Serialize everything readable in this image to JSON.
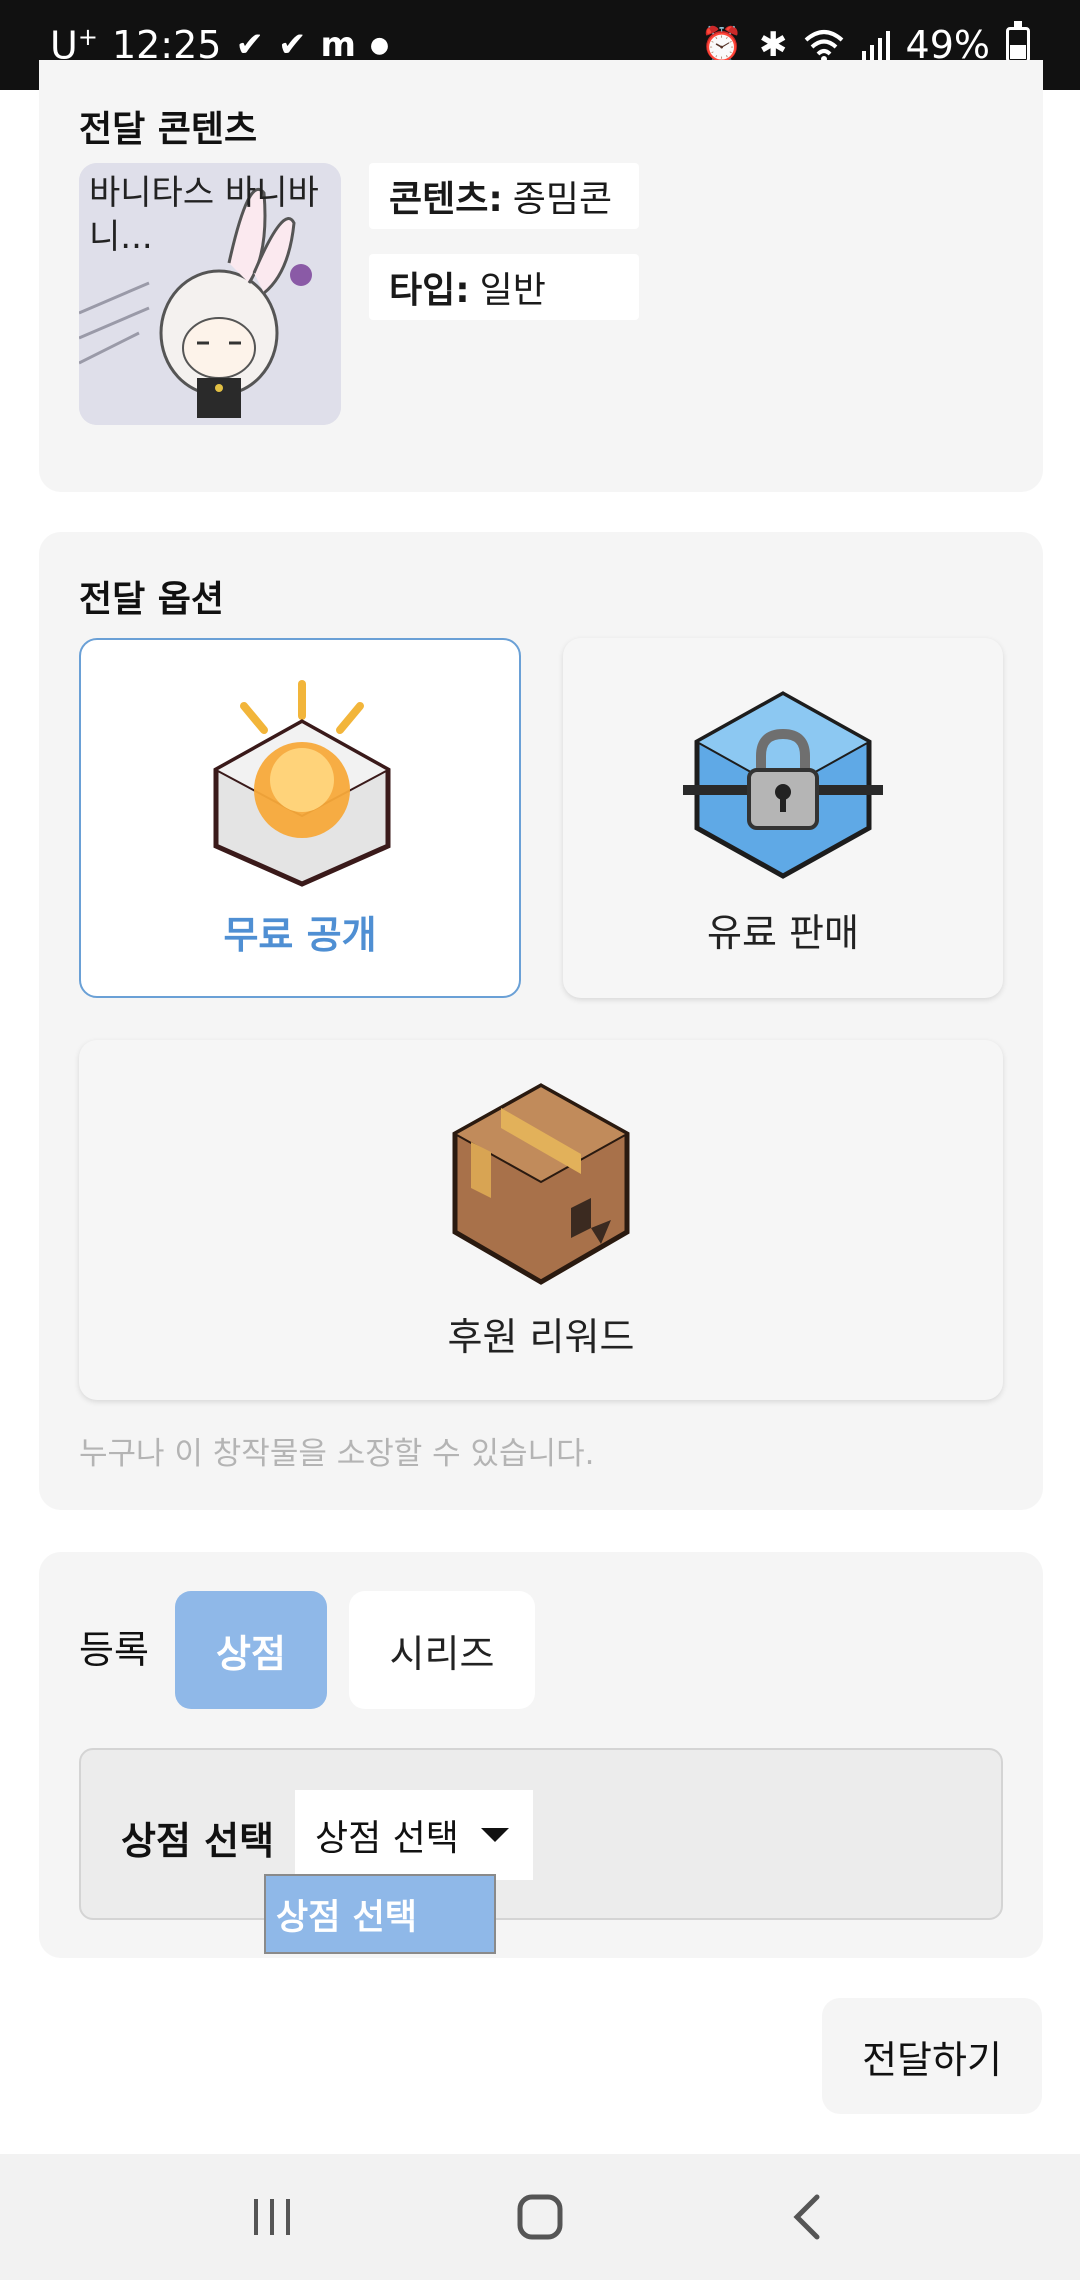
{
  "status_bar": {
    "carrier": "U",
    "carrier_sup": "+",
    "time": "12:25",
    "left_icons": [
      "check-icon",
      "check-icon",
      "messenger-icon",
      "dot-icon"
    ],
    "right_icons": [
      "alarm-icon",
      "bluetooth-icon",
      "wifi-icon",
      "signal-icon"
    ],
    "battery": "49%"
  },
  "content_section": {
    "title": "전달 콘텐츠",
    "thumbnail_caption": "바니타스 바니바니...",
    "content_label": "콘텐츠:",
    "content_value": "종밈콘",
    "type_label": "타입:",
    "type_value": "일반"
  },
  "options_section": {
    "title": "전달 옵션",
    "options": [
      {
        "label": "무료 공개",
        "icon": "sun-box-icon",
        "selected": true
      },
      {
        "label": "유료 판매",
        "icon": "locked-box-icon",
        "selected": false
      },
      {
        "label": "후원 리워드",
        "icon": "package-box-icon",
        "selected": false
      }
    ],
    "description": "누구나 이 창작물을 소장할 수 있습니다."
  },
  "register_section": {
    "label": "등록",
    "tabs": [
      {
        "label": "상점",
        "selected": true
      },
      {
        "label": "시리즈",
        "selected": false
      }
    ],
    "shop_select_label": "상점 선택",
    "shop_select_value": "상점 선택",
    "dropdown_option": "상점 선택"
  },
  "send_button": "전달하기",
  "nav_bar": [
    "recent-apps-icon",
    "home-icon",
    "back-icon"
  ],
  "colors": {
    "accent": "#4f8fd3",
    "selected_tab": "#8fb8e8",
    "card_bg": "#f5f5f5"
  }
}
